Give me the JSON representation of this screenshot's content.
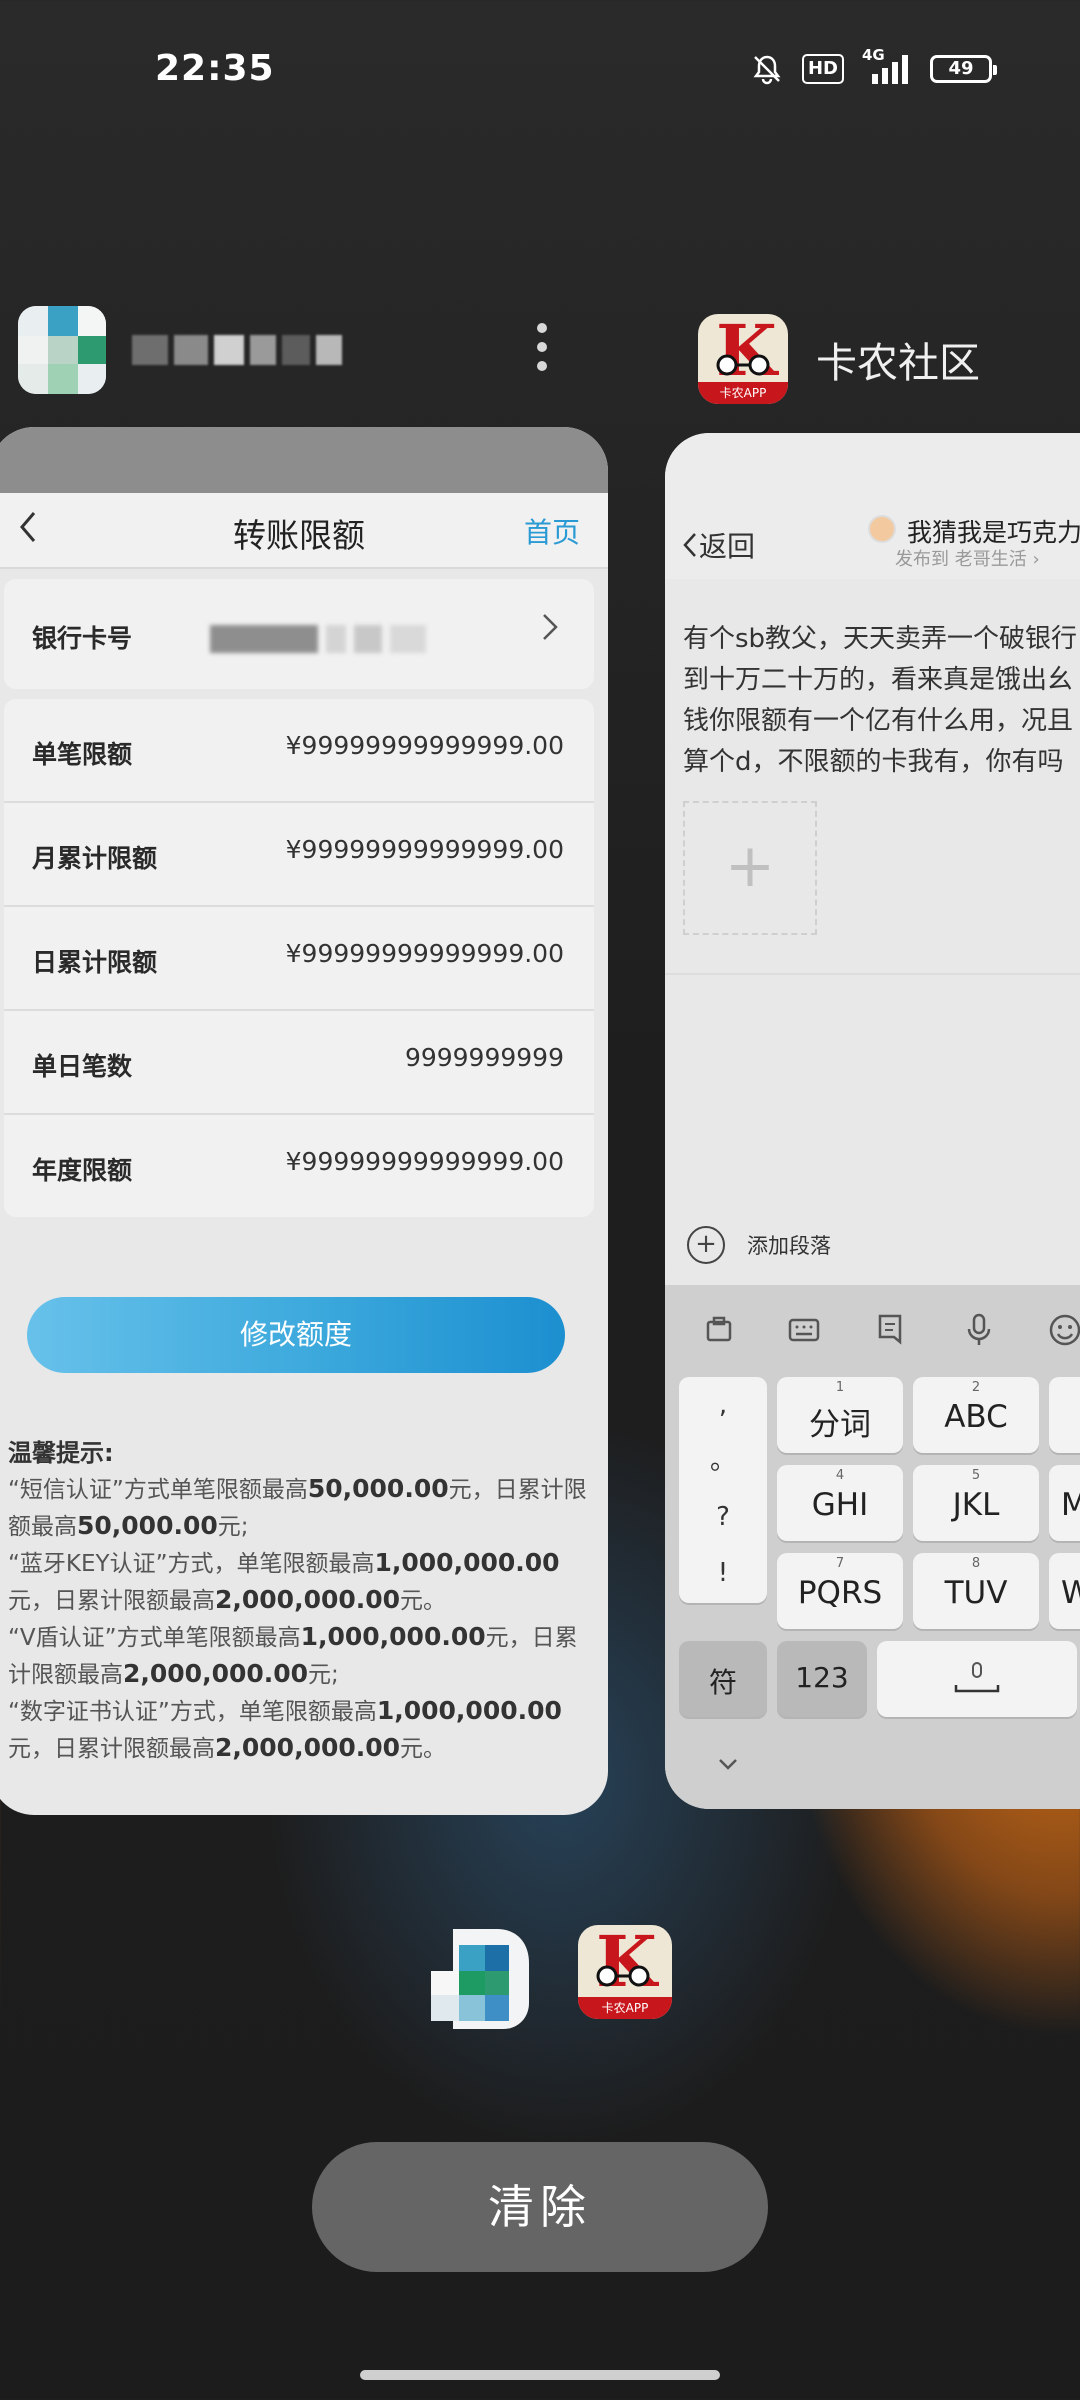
{
  "status_bar": {
    "time": "22:35",
    "hd_label": "HD",
    "net_label": "4G",
    "battery": "49"
  },
  "left_card": {
    "nav": {
      "back_icon": "chevron-left-icon",
      "title": "转账限额",
      "home": "首页"
    },
    "card_no_label": "银行卡号",
    "rows": [
      {
        "label": "单笔限额",
        "value": "¥99999999999999.00"
      },
      {
        "label": "月累计限额",
        "value": "¥99999999999999.00"
      },
      {
        "label": "日累计限额",
        "value": "¥99999999999999.00"
      },
      {
        "label": "单日笔数",
        "value": "9999999999"
      },
      {
        "label": "年度限额",
        "value": "¥99999999999999.00"
      }
    ],
    "modify_button": "修改额度",
    "tips": {
      "title": "温馨提示:",
      "lines": [
        {
          "a": "“短信认证”方式单笔限额最高",
          "b": "50,000.00",
          "c": "元，日累计限额最高",
          "d": "50,000.00",
          "e": "元;"
        },
        {
          "a": "“蓝牙KEY认证”方式，单笔限额最高",
          "b": "1,000,000.00",
          "c": "元，日累计限额最高",
          "d": "2,000,000.00",
          "e": "元。"
        },
        {
          "a": "“V盾认证”方式单笔限额最高",
          "b": "1,000,000.00",
          "c": "元，日累计限额最高",
          "d": "2,000,000.00",
          "e": "元;"
        },
        {
          "a": "“数字证书认证”方式，单笔限额最高",
          "b": "1,000,000.00",
          "c": "元，日累计限额最高",
          "d": "2,000,000.00",
          "e": "元。"
        }
      ]
    }
  },
  "right_app": {
    "name": "卡农社区",
    "icon_banner": "卡农APP",
    "back": "返回",
    "user": "我猜我是巧克力",
    "posted_to": "发布到  老哥生活 ›",
    "post_lines": [
      "有个sb教父，天天卖弄一个破银行",
      "到十万二十万的，看来真是饿出幺",
      "钱你限额有一个亿有什么用，况且",
      "算个d，不限额的卡我有，你有吗"
    ],
    "add_paragraph": "添加段落",
    "keyboard": {
      "punct": [
        ",",
        "。",
        "?",
        "!"
      ],
      "keys": [
        {
          "num": "1",
          "main": "分词"
        },
        {
          "num": "2",
          "main": "ABC"
        },
        {
          "num": "4",
          "main": "GHI"
        },
        {
          "num": "5",
          "main": "JKL"
        },
        {
          "num": "7",
          "main": "PQRS"
        },
        {
          "num": "8",
          "main": "TUV"
        }
      ],
      "partial_right": [
        "M",
        "W"
      ],
      "symbol_key": "符",
      "num_key": "123"
    }
  },
  "bottom": {
    "clear_button": "清除"
  }
}
